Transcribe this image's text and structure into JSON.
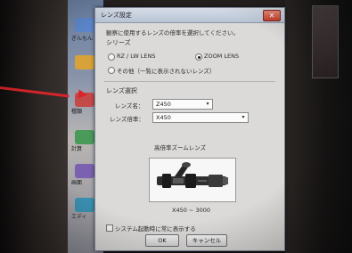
{
  "dialog": {
    "title": "レンズ設定",
    "close_glyph": "✕",
    "instruction": "観察に使用するレンズの倍率を選択してください。",
    "series_group_label": "シリーズ",
    "series_options": [
      {
        "label": "RZ / LW LENS",
        "selected": false
      },
      {
        "label": "ZOOM LENS",
        "selected": true
      },
      {
        "label": "その他（一覧に表示されないレンズ）",
        "selected": false
      }
    ],
    "lens_select_label": "レンズ選択",
    "lens_name_label": "レンズ名：",
    "lens_name_value": "Z450",
    "lens_magnification_label": "レンズ倍率：",
    "lens_magnification_value": "X450",
    "lens_caption": "高倍率ズームレンズ",
    "range_label": "X450 ~ 3000",
    "checkbox_label": "システム起動時に常に表示する",
    "ok_label": "OK",
    "cancel_label": "キャンセル"
  },
  "desktop": {
    "icon_labels": [
      "ぎんもん",
      "種類",
      "計算",
      "画面",
      "エディ"
    ]
  },
  "colors": {
    "annotation_arrow": "#d8242a",
    "dialog_bg": "#dcdad8",
    "titlebar": "#c6d0dd"
  }
}
